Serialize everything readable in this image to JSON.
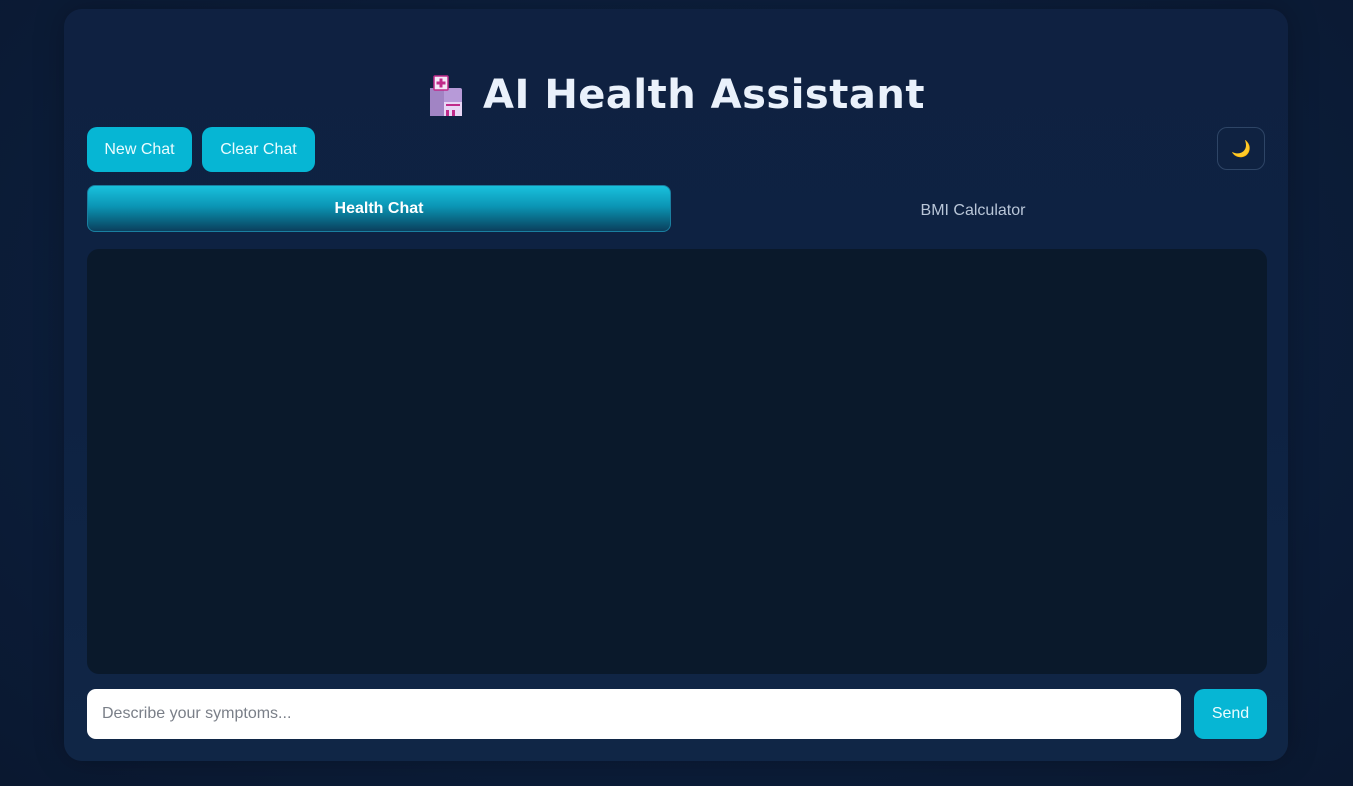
{
  "header": {
    "title": "AI Health Assistant",
    "icon": "hospital-icon"
  },
  "toolbar": {
    "new_chat_label": "New Chat",
    "clear_chat_label": "Clear Chat",
    "theme_toggle_icon": "moon-icon",
    "theme_toggle_glyph": "🌙"
  },
  "tabs": [
    {
      "label": "Health Chat",
      "active": true
    },
    {
      "label": "BMI Calculator",
      "active": false
    }
  ],
  "composer": {
    "placeholder": "Describe your symptoms...",
    "value": "",
    "send_label": "Send"
  },
  "colors": {
    "accent": "#06b6d4",
    "background": "#0c1e3b",
    "chat_background": "#0a192b"
  }
}
